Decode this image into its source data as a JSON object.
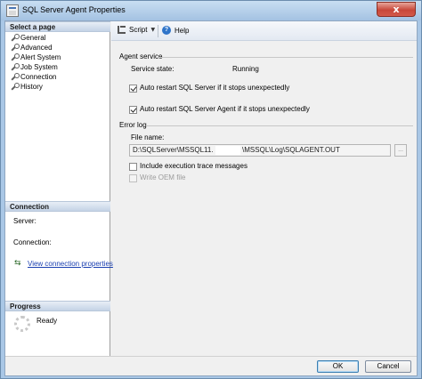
{
  "window": {
    "title": "SQL Server Agent Properties",
    "close_label": "x"
  },
  "sidebar": {
    "select_page_header": "Select a page",
    "pages": [
      {
        "label": "General"
      },
      {
        "label": "Advanced"
      },
      {
        "label": "Alert System"
      },
      {
        "label": "Job System"
      },
      {
        "label": "Connection"
      },
      {
        "label": "History"
      }
    ],
    "connection_header": "Connection",
    "server_label": "Server:",
    "connection_label": "Connection:",
    "view_connection_link": "View connection properties",
    "progress_header": "Progress",
    "progress_status": "Ready"
  },
  "toolbar": {
    "script_label": "Script",
    "help_label": "Help"
  },
  "agent_service": {
    "group_label": "Agent service",
    "service_state_label": "Service state:",
    "service_state_value": "Running",
    "auto_restart_sql_label": "Auto restart SQL Server if it stops unexpectedly",
    "auto_restart_sql_checked": true,
    "auto_restart_agent_label": "Auto restart SQL Server Agent if it stops unexpectedly",
    "auto_restart_agent_checked": true
  },
  "error_log": {
    "group_label": "Error log",
    "file_name_label": "File name:",
    "file_name_prefix": "D:\\SQLServer\\MSSQL11.",
    "file_name_suffix": "\\MSSQL\\Log\\SQLAGENT.OUT",
    "browse_label": "...",
    "include_trace_label": "Include execution trace messages",
    "include_trace_checked": false,
    "write_oem_label": "Write OEM file",
    "write_oem_checked": false
  },
  "buttons": {
    "ok_label": "OK",
    "cancel_label": "Cancel"
  }
}
